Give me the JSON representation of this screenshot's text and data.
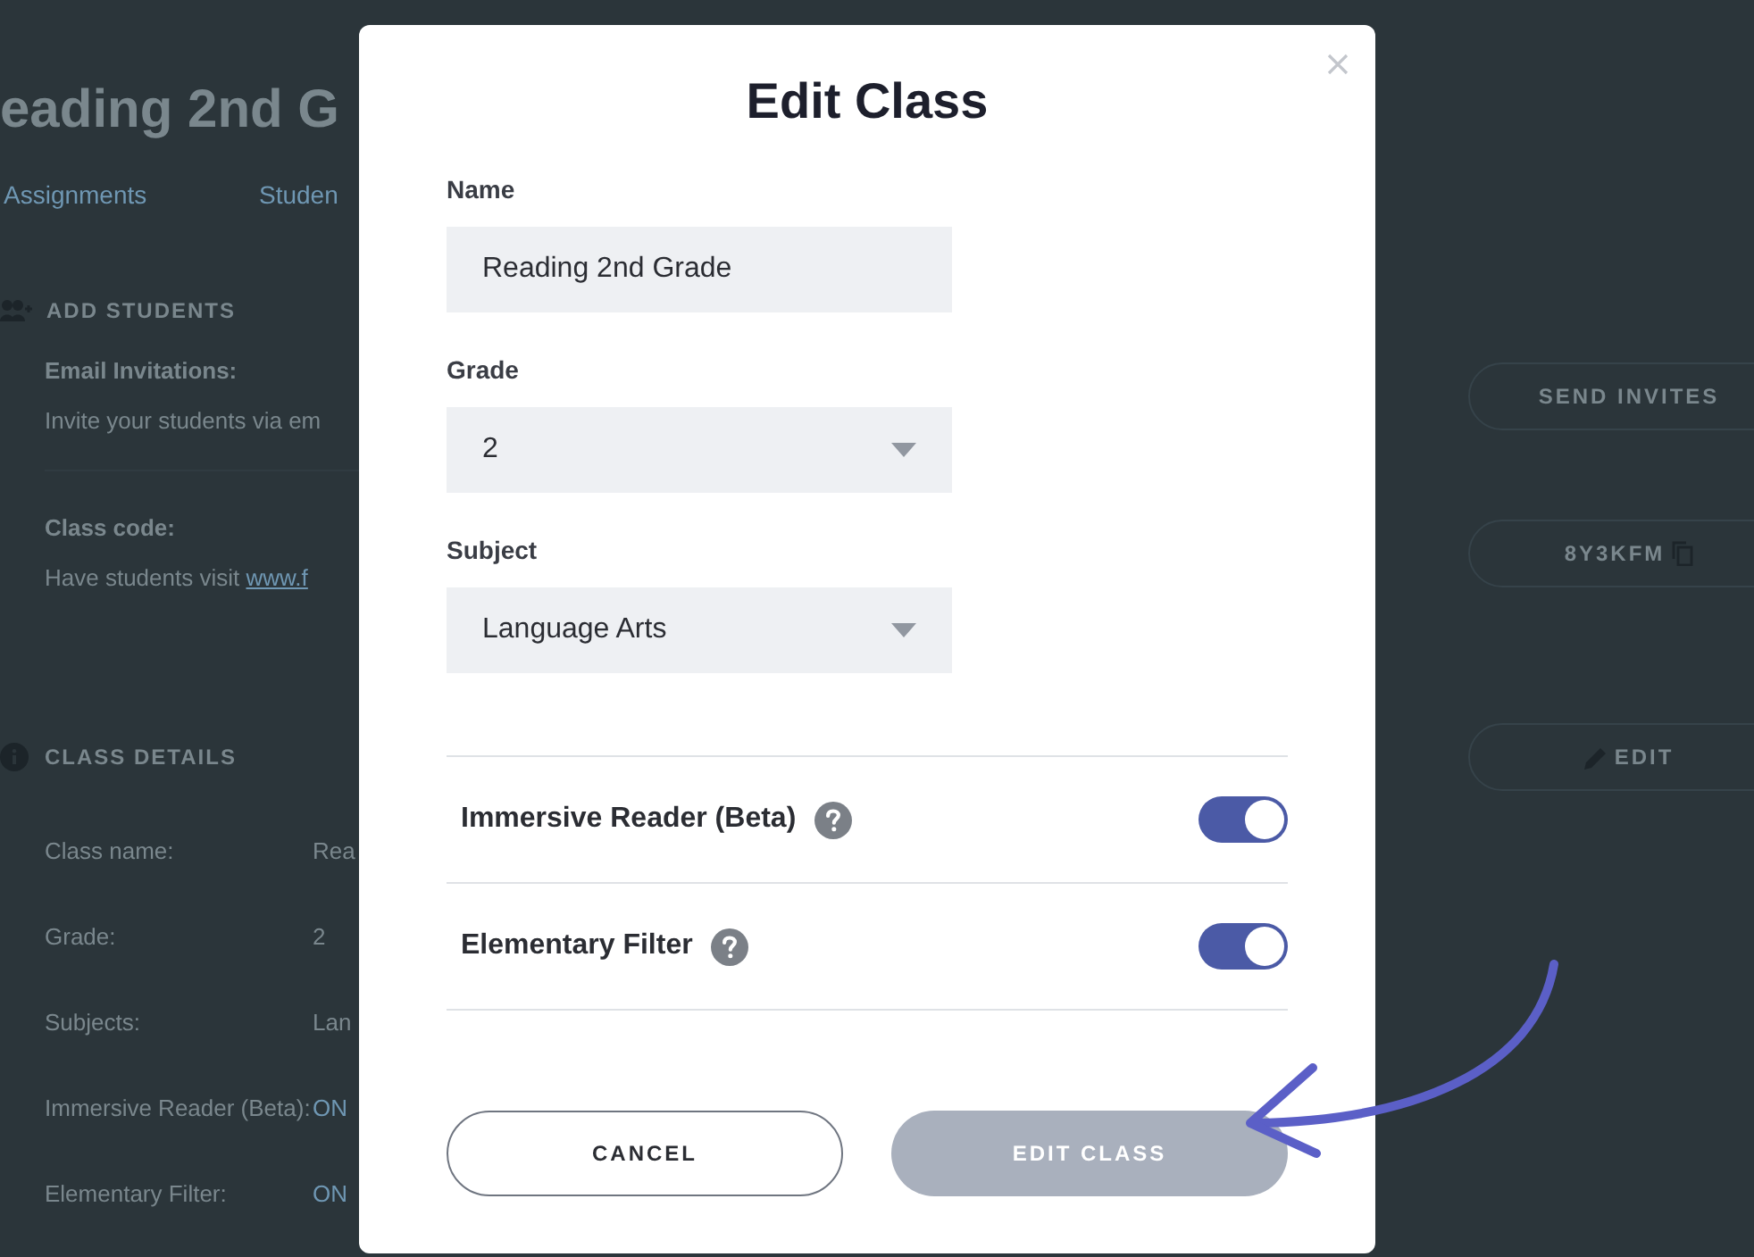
{
  "background_page": {
    "title": "eading 2nd G",
    "tabs": [
      {
        "label": "Assignments"
      },
      {
        "label": "Studen"
      }
    ],
    "add_students": {
      "heading": "ADD STUDENTS",
      "email": {
        "label": "Email Invitations:",
        "text": "Invite your students via em",
        "button": "SEND INVITES"
      },
      "class_code": {
        "label": "Class code:",
        "text": "Have students visit",
        "link": "www.f",
        "button": "8Y3KFM"
      }
    },
    "class_details": {
      "heading": "CLASS DETAILS",
      "button": "EDIT",
      "rows": [
        {
          "label": "Class name:",
          "value": "Rea"
        },
        {
          "label": "Grade:",
          "value": "2"
        },
        {
          "label": "Subjects:",
          "value": "Lan"
        },
        {
          "label": "Immersive Reader (Beta):",
          "value": "ON"
        },
        {
          "label": "Elementary Filter:",
          "value": "ON"
        }
      ]
    }
  },
  "modal": {
    "title": "Edit Class",
    "fields": [
      {
        "kind": "text",
        "label": "Name",
        "value": "Reading 2nd Grade"
      },
      {
        "kind": "select",
        "label": "Grade",
        "value": "2"
      },
      {
        "kind": "select",
        "label": "Subject",
        "value": "Language Arts"
      }
    ],
    "toggles": [
      {
        "label": "Immersive Reader (Beta)",
        "on": true
      },
      {
        "label": "Elementary Filter",
        "on": true
      }
    ],
    "cancel_button": "CANCEL",
    "submit_button": {
      "label": "EDIT CLASS",
      "disabled": true
    }
  }
}
